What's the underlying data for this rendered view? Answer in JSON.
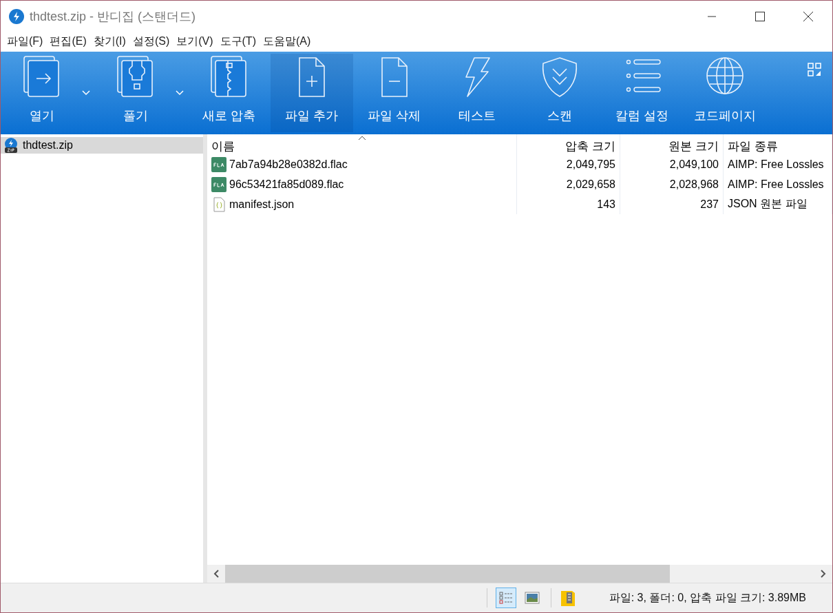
{
  "window": {
    "title": "thdtest.zip - 반디집 (스탠더드)"
  },
  "menu": [
    "파일(F)",
    "편집(E)",
    "찾기(I)",
    "설정(S)",
    "보기(V)",
    "도구(T)",
    "도움말(A)"
  ],
  "toolbar": [
    {
      "kind": "open",
      "label": "열기",
      "dropdown": true,
      "highlighted": false
    },
    {
      "kind": "extract",
      "label": "풀기",
      "dropdown": true,
      "highlighted": false
    },
    {
      "kind": "compress",
      "label": "새로 압축",
      "dropdown": false,
      "highlighted": false
    },
    {
      "kind": "add",
      "label": "파일 추가",
      "dropdown": false,
      "highlighted": true
    },
    {
      "kind": "delete",
      "label": "파일 삭제",
      "dropdown": false,
      "highlighted": false
    },
    {
      "kind": "test",
      "label": "테스트",
      "dropdown": false,
      "highlighted": false
    },
    {
      "kind": "scan",
      "label": "스캔",
      "dropdown": false,
      "highlighted": false
    },
    {
      "kind": "columns",
      "label": "칼럼 설정",
      "dropdown": false,
      "highlighted": false
    },
    {
      "kind": "codepage",
      "label": "코드페이지",
      "dropdown": false,
      "highlighted": false
    }
  ],
  "tree": [
    {
      "label": "thdtest.zip",
      "selected": true
    }
  ],
  "table": {
    "columns": [
      {
        "label": "이름",
        "sorted": true
      },
      {
        "label": "압축 크기",
        "sorted": false
      },
      {
        "label": "원본 크기",
        "sorted": false
      },
      {
        "label": "파일 종류",
        "sorted": false
      }
    ],
    "rows": [
      {
        "kind": "flac",
        "name": "7ab7a94b28e0382d.flac",
        "packed": "2,049,795",
        "original": "2,049,100",
        "type": "AIMP: Free Lossles"
      },
      {
        "kind": "flac",
        "name": "96c53421fa85d089.flac",
        "packed": "2,029,658",
        "original": "2,028,968",
        "type": "AIMP: Free Lossles"
      },
      {
        "kind": "json",
        "name": "manifest.json",
        "packed": "143",
        "original": "237",
        "type": "JSON 원본 파일"
      }
    ]
  },
  "status_bar": {
    "views": [
      {
        "kind": "list",
        "selected": true
      },
      {
        "kind": "picture",
        "selected": false
      }
    ],
    "text": "파일: 3, 폴더: 0, 압축 파일 크기: 3.89MB"
  }
}
